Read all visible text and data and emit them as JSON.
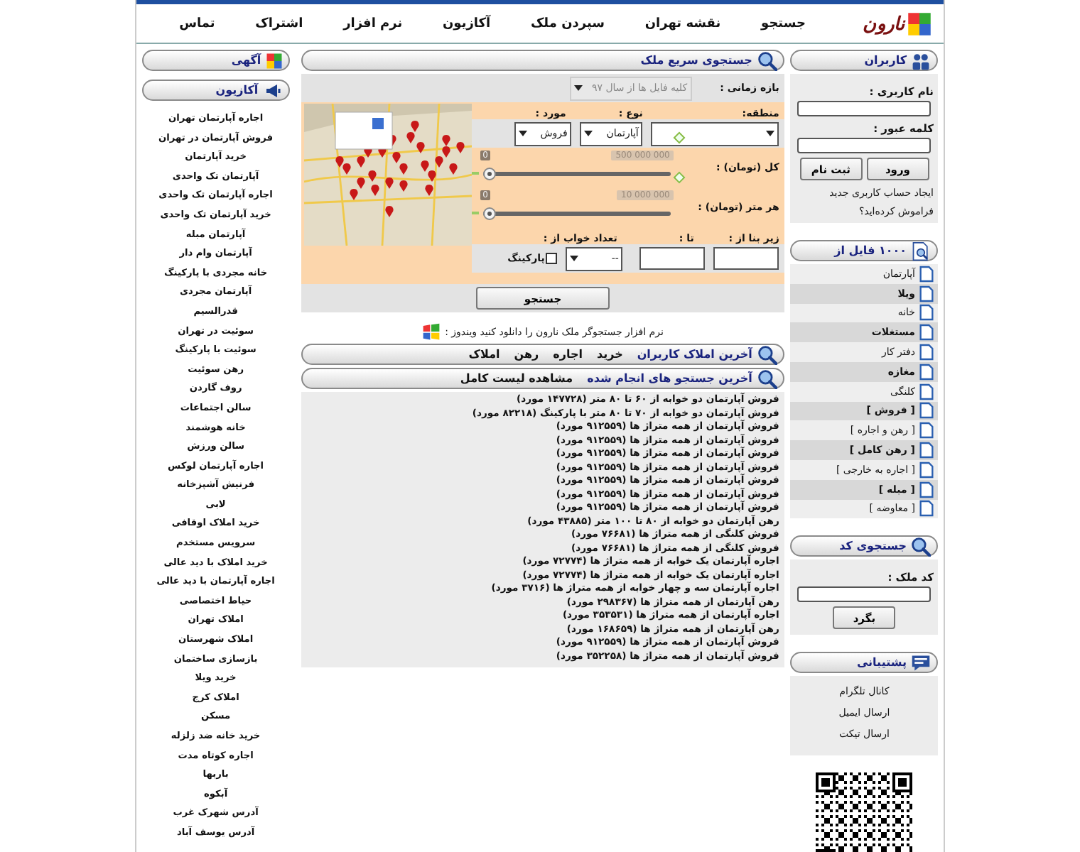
{
  "logo": {
    "text": "نارون"
  },
  "nav": [
    "جستجو",
    "نقشه تهران",
    "سپردن ملک",
    "آکازیون",
    "نرم افزار",
    "اشتراک",
    "تماس"
  ],
  "users": {
    "title": "کاربران",
    "username_label": "نام کاربری :",
    "password_label": "کلمه عبور :",
    "login_button": "ورود",
    "register_button": "ثبت نام",
    "links": [
      "ایجاد حساب کاربری جدید",
      "فراموش کرده‌اید؟"
    ]
  },
  "files": {
    "title": "۱۰۰۰ فایل از",
    "items": [
      "آپارتمان",
      "ویلا",
      "خانه",
      "مستغلات",
      "دفتر کار",
      "مغازه",
      "کلنگی",
      "[ فروش ]",
      "[ رهن و اجاره ]",
      "[ رهن کامل ]",
      "[ اجاره به خارجی ]",
      "[ مبله ]",
      "[ معاوضه ]"
    ]
  },
  "code_search": {
    "title": "جستجوی کد",
    "label": "کد ملک :",
    "button": "بگرد"
  },
  "support": {
    "title": "پشتیبانی",
    "links": [
      "کانال تلگرام",
      "ارسال ایمیل",
      "ارسال تیکت"
    ]
  },
  "quick_search": {
    "title": "جستجوی سریع ملک",
    "period_label": "بازه زمانی :",
    "period_value": "کلیه فایل ها از سال ۹۷",
    "region_label": "منطقه:",
    "type_label": "نوع :",
    "deal_label": "مورد :",
    "type_value": "آپارتمان",
    "deal_value": "فروش",
    "sliders": [
      {
        "label": "کل (تومان) :",
        "reading": "500 000 000",
        "min": "0",
        "level": 0
      },
      {
        "label": "هر متر (تومان) :",
        "reading": "10 000 000",
        "min": "0",
        "level": 0
      }
    ],
    "area_from_label": "زیر بنا از :",
    "area_to_label": "تا :",
    "rooms_label": "تعداد خواب از :",
    "rooms_value": "--",
    "parking": {
      "label": "پارکینگ",
      "checked": false
    },
    "search_button": "جستجو",
    "download_text": "نرم افزار جستجوگر ملک نارون را دانلود کنید ویندوز :"
  },
  "latest_listings": {
    "title": "آخرین املاک کاربران",
    "links": [
      "خرید",
      "اجاره",
      "رهن",
      "املاک"
    ]
  },
  "latest_searches": {
    "title": "آخرین جستجو های انجام شده",
    "link": "مشاهده لیست کامل",
    "items": [
      "فروش آپارتمان دو خوابه از ۶۰ تا ۸۰ متر (۱۴۷۷۲۸ مورد)",
      "فروش آپارتمان دو خوابه از ۷۰ تا ۸۰ متر با پارکینگ (۸۲۲۱۸ مورد)",
      "فروش آپارتمان از همه متراژ ها (۹۱۲۵۵۹ مورد)",
      "فروش آپارتمان از همه متراژ ها (۹۱۲۵۵۹ مورد)",
      "فروش آپارتمان از همه متراژ ها (۹۱۲۵۵۹ مورد)",
      "فروش آپارتمان از همه متراژ ها (۹۱۲۵۵۹ مورد)",
      "فروش آپارتمان از همه متراژ ها (۹۱۲۵۵۹ مورد)",
      "فروش آپارتمان از همه متراژ ها (۹۱۲۵۵۹ مورد)",
      "فروش آپارتمان از همه متراژ ها (۹۱۲۵۵۹ مورد)",
      "رهن آپارتمان دو خوابه از ۸۰ تا ۱۰۰ متر (۴۳۸۸۵ مورد)",
      "فروش کلنگی از همه متراژ ها (۷۶۶۸۱ مورد)",
      "فروش کلنگی از همه متراژ ها (۷۶۶۸۱ مورد)",
      "اجاره آپارتمان یک خوابه از همه متراژ ها (۷۲۷۷۴ مورد)",
      "اجاره آپارتمان یک خوابه از همه متراژ ها (۷۲۷۷۴ مورد)",
      "اجاره آپارتمان سه و چهار خوابه از همه متراژ ها (۳۷۱۶ مورد)",
      "رهن آپارتمان از همه متراژ ها (۲۹۸۳۶۷ مورد)",
      "اجاره آپارتمان از همه متراژ ها (۳۵۳۵۳۱ مورد)",
      "رهن آپارتمان از همه متراژ ها (۱۶۸۶۵۹ مورد)",
      "فروش آپارتمان از همه متراژ ها (۹۱۲۵۵۹ مورد)",
      "فروش آپارتمان از همه متراژ ها (۳۵۲۲۵۸ مورد)"
    ]
  },
  "left": {
    "ads_title": "آگهی",
    "akazion_title": "آکازیون",
    "links": [
      "اجاره آپارتمان تهران",
      "فروش آپارتمان در تهران",
      "خرید آپارتمان",
      "آپارتمان تک واحدی",
      "اجاره آپارتمان تک واحدی",
      "خرید آپارتمان تک واحدی",
      "آپارتمان مبله",
      "آپارتمان وام دار",
      "خانه مجردی با پارکینگ",
      "آپارتمان مجردی",
      "قدرالسیم",
      "سوئیت در تهران",
      "سوئیت با پارکینگ",
      "رهن سوئیت",
      "روف گاردن",
      "سالن اجتماعات",
      "خانه هوشمند",
      "سالن ورزش",
      "اجاره آپارتمان لوکس",
      "فرنیش آشپزخانه",
      "لابی",
      "خرید املاک اوقافی",
      "سرویس مستخدم",
      "خرید املاک با دید عالی",
      "اجاره آپارتمان با دید عالی",
      "حیاط اختصاصی",
      "املاک تهران",
      "املاک شهرستان",
      "بازسازی ساختمان",
      "خرید ویلا",
      "املاک کرج",
      "مسکن",
      "خرید خانه ضد زلزله",
      "اجاره کوتاه مدت",
      "باربها",
      "آبکوه",
      "آدرس شهرک غرب",
      "آدرس یوسف آباد"
    ]
  }
}
